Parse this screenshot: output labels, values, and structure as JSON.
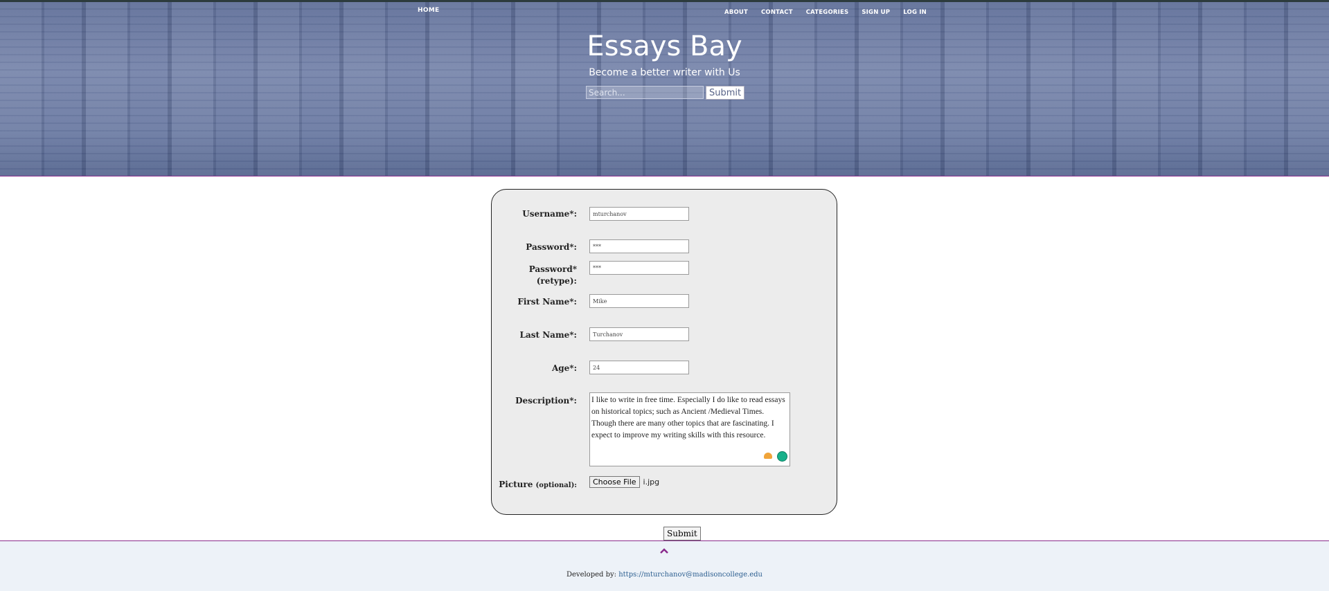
{
  "nav": {
    "home": "HOME",
    "items": [
      "ABOUT",
      "CONTACT",
      "CATEGORIES",
      "SIGN UP",
      "LOG IN"
    ]
  },
  "header": {
    "title": "Essays Bay",
    "tagline": "Become a better writer with Us",
    "search_placeholder": "Search...",
    "search_button": "Submit"
  },
  "form": {
    "username_label": "Username*:",
    "username_value": "mturchanov",
    "password_label": "Password*:",
    "password_value": "***",
    "password_retype_label_1": "Password*",
    "password_retype_label_2": "(retype):",
    "password_retype_value": "***",
    "first_name_label": "First Name*:",
    "first_name_value": "Mike",
    "last_name_label": "Last Name*:",
    "last_name_value": "Turchanov",
    "age_label": "Age*:",
    "age_value": "24",
    "description_label": "Description*:",
    "description_value": "I like to write in free time. Especially I do like to read essays on historical topics; such as Ancient /Medieval Times. Though there are many other topics that are fascinating. I expect to improve my writing skills with this resource.",
    "picture_label": "Picture",
    "picture_optional": "(optional):",
    "choose_file_button": "Choose File",
    "file_name": "i.jpg",
    "submit_button": "Submit"
  },
  "footer": {
    "developed_by": "Developed by:",
    "link_text": "https://mturchanov@madisoncollege.edu"
  },
  "colors": {
    "accent": "#8a2b8c",
    "panel_bg": "#ececec",
    "footer_bg": "#edf2f8"
  }
}
